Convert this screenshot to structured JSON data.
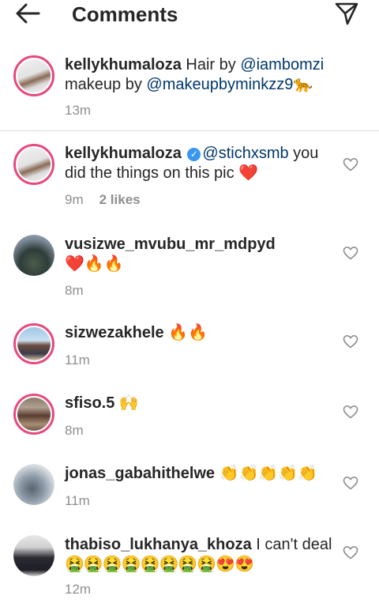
{
  "header": {
    "title": "Comments"
  },
  "caption": {
    "username": "kellykhumaloza",
    "text_a": " Hair by ",
    "mention_a": "@iambomzi",
    "text_b": " makeup by ",
    "mention_b": "@makeupbyminkzz9",
    "emoji": " 🐆",
    "time": "13m"
  },
  "comments": [
    {
      "username": "kellykhumaloza",
      "verified_icon": "verified-badge",
      "mention": "@stichxsmb",
      "text": " you did the things on this pic ",
      "emoji": "❤️",
      "time": "9m",
      "likes": "2 likes"
    },
    {
      "username": "vusizwe_mvubu_mr_mdpyd",
      "text": "",
      "emoji": "❤️🔥🔥",
      "time": "8m"
    },
    {
      "username": "sizwezakhele",
      "text": "",
      "emoji": "🔥🔥",
      "time": "11m"
    },
    {
      "username": "sfiso.5",
      "text": "",
      "emoji": "🙌",
      "time": "8m"
    },
    {
      "username": "jonas_gabahithelwe",
      "text": "",
      "emoji": "👏👏👏👏👏",
      "time": "11m"
    },
    {
      "username": "thabiso_lukhanya_khoza",
      "text": " I can't deal ",
      "emoji": "🤮🤮🤮🤮🤮🤮🤮🤮😍😍",
      "time": "12m"
    }
  ],
  "colors": {
    "ring": "#e7487e",
    "mention": "#00376b",
    "meta": "#8e8e8e",
    "verified": "#3897f0"
  }
}
